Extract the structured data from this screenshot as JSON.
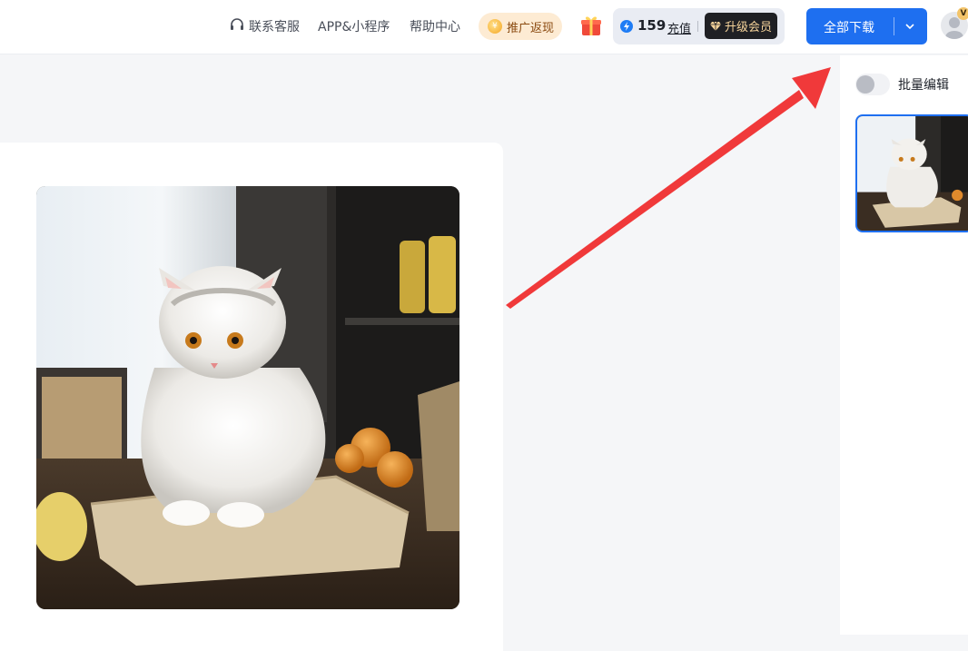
{
  "header": {
    "nav": {
      "customer_service": "联系客服",
      "app_miniprogram": "APP&小程序",
      "help_center": "帮助中心"
    },
    "promo_label": "推广返现",
    "credits": {
      "count": "159",
      "recharge_label": "充值",
      "upgrade_label": "升级会员"
    },
    "download_all_label": "全部下载",
    "avatar_badge": "V"
  },
  "side_panel": {
    "batch_edit_label": "批量编辑",
    "batch_edit_on": false
  },
  "colors": {
    "primary": "#1e6ff0",
    "annotation_arrow": "#f0393a",
    "promo_bg": "#fdebd3",
    "vip_bg": "#1f2024",
    "vip_text": "#f6d49b"
  },
  "icons": [
    "headset-icon",
    "coin-icon",
    "gift-icon",
    "bolt-icon",
    "diamond-icon",
    "chevron-down-icon",
    "avatar-icon"
  ]
}
